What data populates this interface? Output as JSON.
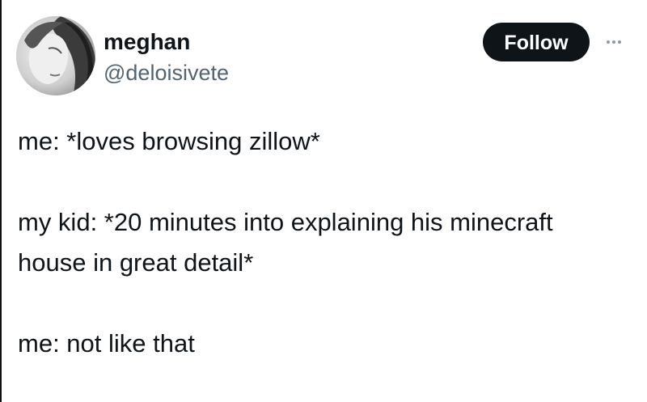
{
  "tweet": {
    "author": {
      "display_name": "meghan",
      "handle": "@deloisivete"
    },
    "follow_label": "Follow",
    "more_icon": "more-horizontal-icon",
    "lines": [
      "me: *loves browsing zillow*",
      "",
      "my kid: *20 minutes into explaining his minecraft",
      "house in great detail*",
      "",
      "me: not like that"
    ]
  },
  "colors": {
    "text": "#0f1419",
    "secondary_text": "#536471",
    "button_bg": "#0f1419",
    "button_text": "#ffffff",
    "more_icon": "#8c98a3"
  }
}
